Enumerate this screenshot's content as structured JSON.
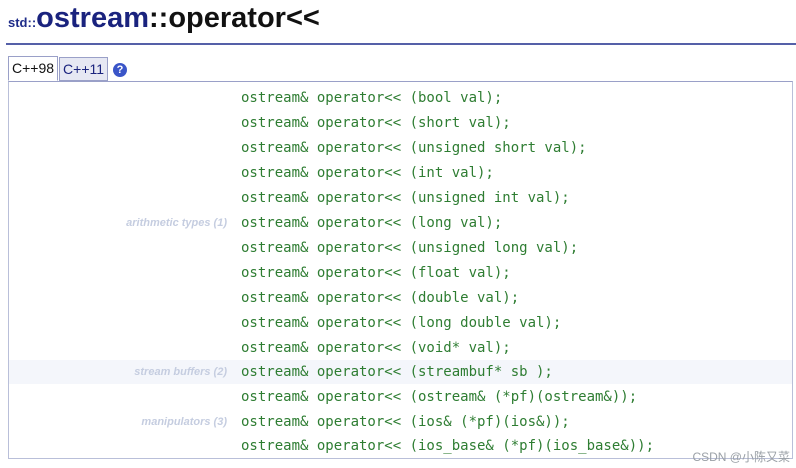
{
  "header": {
    "namespace": "std::",
    "class_name": "ostream",
    "operator": "::operator<<"
  },
  "tabs": [
    {
      "label": "C++98",
      "active": true
    },
    {
      "label": "C++11",
      "active": false
    }
  ],
  "help_icon": {
    "symbol": "?",
    "icon": "help-icon"
  },
  "groups": {
    "arithmetic": "arithmetic types (1)",
    "stream_buffers": "stream buffers (2)",
    "manipulators": "manipulators (3)"
  },
  "signatures": [
    "ostream& operator<< (bool val);",
    "ostream& operator<< (short val);",
    "ostream& operator<< (unsigned short val);",
    "ostream& operator<< (int val);",
    "ostream& operator<< (unsigned int val);",
    "ostream& operator<< (long val);",
    "ostream& operator<< (unsigned long val);",
    "ostream& operator<< (float val);",
    "ostream& operator<< (double val);",
    "ostream& operator<< (long double val);",
    "ostream& operator<< (void* val);",
    "ostream& operator<< (streambuf* sb );",
    "ostream& operator<< (ostream& (*pf)(ostream&));",
    "ostream& operator<< (ios& (*pf)(ios&));",
    "ostream& operator<< (ios_base& (*pf)(ios_base&));"
  ],
  "watermark": "CSDN @小陈又菜",
  "colors": {
    "title": "#1a237e",
    "code": "#2e7d32",
    "group_label": "#c5cde0",
    "rule": "#5560a8"
  }
}
